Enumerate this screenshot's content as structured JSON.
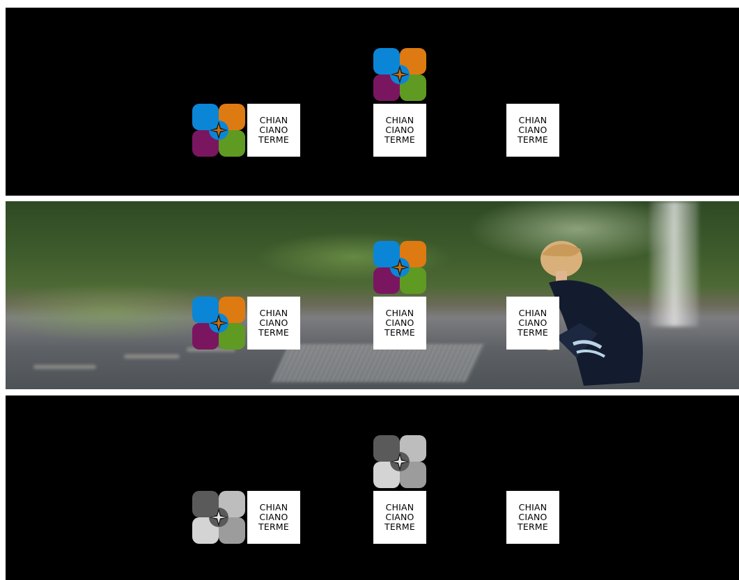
{
  "wordmark": {
    "line1": "CHIAN",
    "line2": "CIANO",
    "line3": "TERME"
  },
  "colors": {
    "blue": "#0b86d6",
    "orange": "#de7a12",
    "purple": "#7a1660",
    "green": "#5f9a22",
    "gray_dark": "#5a5a5a",
    "gray_mid": "#9c9c9c",
    "gray_light": "#cfcfcf"
  },
  "icons": {
    "logo_mark": "four-petal-star-logo-icon"
  }
}
